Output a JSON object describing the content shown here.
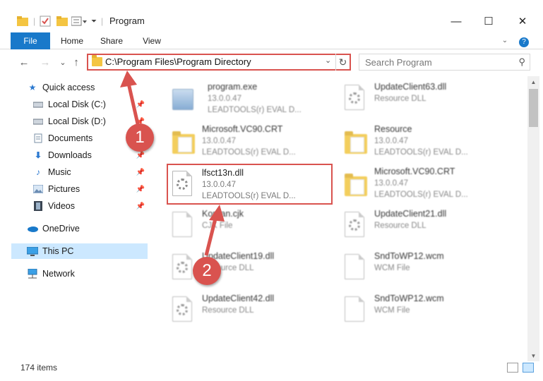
{
  "window": {
    "title": "Program",
    "minimize": "—",
    "maximize": "☐",
    "close": "✕"
  },
  "ribbon": {
    "tabs": [
      "File",
      "Home",
      "Share",
      "View"
    ],
    "help": "?"
  },
  "navigation": {
    "back": "←",
    "forward": "→",
    "recent": "⌄",
    "up": "↑"
  },
  "address": {
    "path": "C:\\Program Files\\Program Directory",
    "refresh": "↻"
  },
  "search": {
    "placeholder": "Search Program"
  },
  "sidebar": {
    "items": [
      {
        "label": "Quick access",
        "icon": "star-icon"
      },
      {
        "label": "Local Disk (C:)",
        "icon": "drive-icon"
      },
      {
        "label": "Local Disk (D:)",
        "icon": "drive-icon"
      },
      {
        "label": "Documents",
        "icon": "documents-icon"
      },
      {
        "label": "Downloads",
        "icon": "download-icon"
      },
      {
        "label": "Music",
        "icon": "music-icon"
      },
      {
        "label": "Pictures",
        "icon": "pictures-icon"
      },
      {
        "label": "Videos",
        "icon": "videos-icon"
      },
      {
        "label": "OneDrive",
        "icon": "cloud-icon"
      },
      {
        "label": "This PC",
        "icon": "computer-icon"
      },
      {
        "label": "Network",
        "icon": "network-icon"
      }
    ]
  },
  "files": [
    {
      "name": "program.exe",
      "line2": "13.0.0.47",
      "line3": "LEADTOOLS(r) EVAL D...",
      "kind": "exe"
    },
    {
      "name": "UpdateClient63.dll",
      "line2": "Resource DLL",
      "line3": "",
      "kind": "dll"
    },
    {
      "name": "Microsoft.VC90.CRT",
      "line2": "13.0.0.47",
      "line3": "LEADTOOLS(r) EVAL D...",
      "kind": "folder"
    },
    {
      "name": "Resource",
      "line2": "13.0.0.47",
      "line3": "LEADTOOLS(r) EVAL D...",
      "kind": "folder"
    },
    {
      "name": "lfsct13n.dll",
      "line2": "13.0.0.47",
      "line3": "LEADTOOLS(r) EVAL D...",
      "kind": "dll"
    },
    {
      "name": "Microsoft.VC90.CRT",
      "line2": "13.0.0.47",
      "line3": "LEADTOOLS(r) EVAL D...",
      "kind": "folder"
    },
    {
      "name": "Korean.cjk",
      "line2": "CJK File",
      "line3": "",
      "kind": "file"
    },
    {
      "name": "UpdateClient21.dll",
      "line2": "Resource DLL",
      "line3": "",
      "kind": "dll"
    },
    {
      "name": "UpdateClient19.dll",
      "line2": "Resource DLL",
      "line3": "",
      "kind": "dll"
    },
    {
      "name": "SndToWP12.wcm",
      "line2": "WCM File",
      "line3": "",
      "kind": "file"
    },
    {
      "name": "UpdateClient42.dll",
      "line2": "Resource DLL",
      "line3": "",
      "kind": "dll"
    },
    {
      "name": "SndToWP12.wcm",
      "line2": "WCM File",
      "line3": "",
      "kind": "file"
    }
  ],
  "status": {
    "item_count": "174 items"
  },
  "annotations": {
    "step1": "1",
    "step2": "2"
  },
  "colors": {
    "accent": "#1979ca",
    "annotation": "#d9534f",
    "selection": "#cce8ff"
  }
}
